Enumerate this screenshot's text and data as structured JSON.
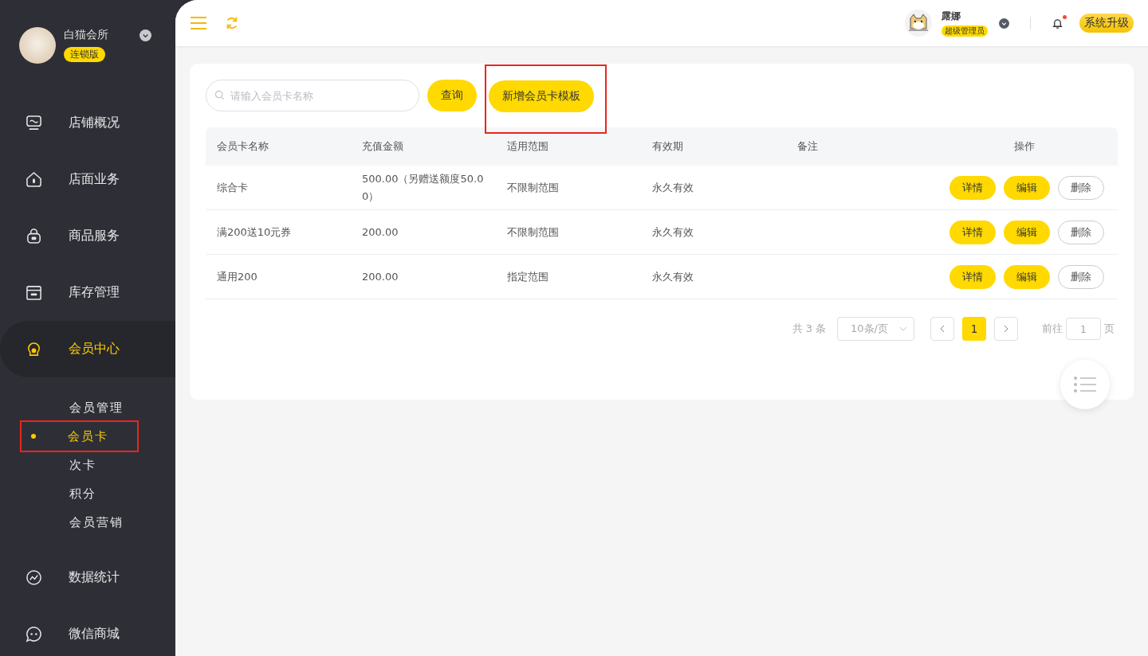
{
  "sidebar": {
    "store_name": "白猫会所",
    "edition": "连锁版",
    "items": [
      {
        "label": "店铺概况",
        "selected": false
      },
      {
        "label": "店面业务",
        "selected": false
      },
      {
        "label": "商品服务",
        "selected": false
      },
      {
        "label": "库存管理",
        "selected": false
      },
      {
        "label": "会员中心",
        "selected": true,
        "children": [
          {
            "label": "会员管理",
            "selected": false,
            "highlighted": false
          },
          {
            "label": "会员卡",
            "selected": true,
            "highlighted": true
          },
          {
            "label": "次卡",
            "selected": false,
            "highlighted": false
          },
          {
            "label": "积分",
            "selected": false,
            "highlighted": false
          },
          {
            "label": "会员营销",
            "selected": false,
            "highlighted": false
          }
        ]
      },
      {
        "label": "数据统计",
        "selected": false
      },
      {
        "label": "微信商城",
        "selected": false
      }
    ]
  },
  "topbar": {
    "user_name": "露娜",
    "role": "超级管理员",
    "has_notification": true,
    "upgrade_button": "系统升级"
  },
  "toolbar": {
    "search": {
      "placeholder": "请输入会员卡名称"
    },
    "query_button": "查询",
    "add_button": {
      "label": "新增会员卡模板",
      "highlighted": true
    }
  },
  "table": {
    "columns": [
      "会员卡名称",
      "充值金额",
      "适用范围",
      "有效期",
      "备注",
      "操作"
    ],
    "rows": [
      {
        "name": "综合卡",
        "amount": "500.00（另赠送额度50.00）",
        "scope": "不限制范围",
        "validity": "永久有效",
        "actions": [
          "详情",
          "编辑",
          "删除"
        ]
      },
      {
        "name": "满200送10元券",
        "amount": "200.00",
        "scope": "不限制范围",
        "validity": "永久有效",
        "actions": [
          "详情",
          "编辑",
          "删除"
        ]
      },
      {
        "name": "通用200",
        "amount": "200.00",
        "scope": "指定范围",
        "validity": "永久有效",
        "actions": [
          "详情",
          "编辑",
          "删除"
        ]
      }
    ]
  },
  "pagination": {
    "total": "共 3 条",
    "page_size": "10条/页",
    "pages": [
      {
        "label": "1",
        "selected": true
      }
    ],
    "goto_label": "前往",
    "goto_value": "1",
    "goto_suffix": "页"
  }
}
